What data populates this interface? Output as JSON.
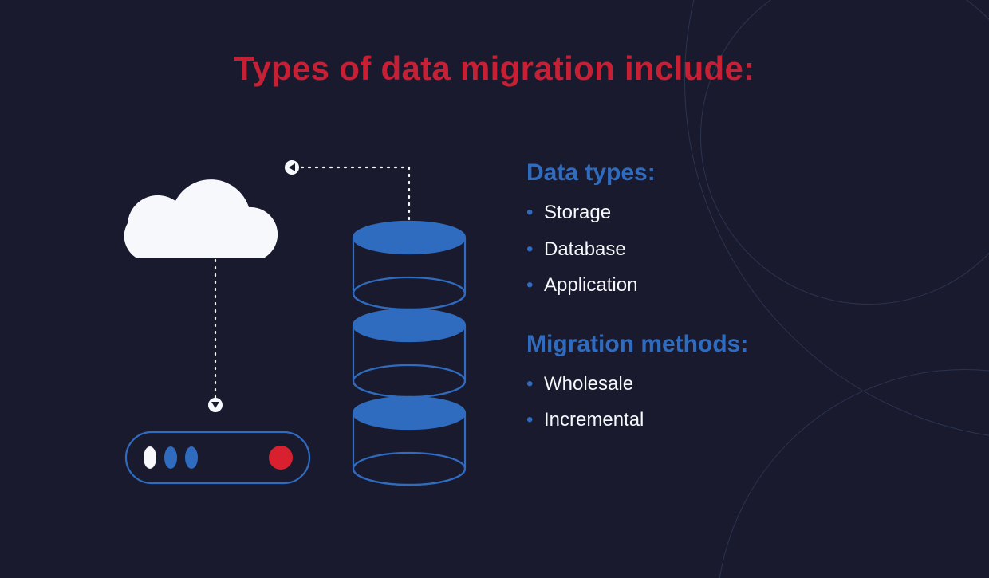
{
  "title": "Types of data migration include:",
  "sections": [
    {
      "heading": "Data types:",
      "items": [
        "Storage",
        "Database",
        "Application"
      ]
    },
    {
      "heading": "Migration methods:",
      "items": [
        "Wholesale",
        "Incremental"
      ]
    }
  ],
  "colors": {
    "background": "#191a2e",
    "title": "#c72035",
    "accent_blue": "#2f6cc0",
    "text": "#f7f8fc",
    "red_dot": "#d8202f"
  },
  "diagram": {
    "nodes": [
      "cloud",
      "database-stack",
      "server-device"
    ],
    "arrows": [
      {
        "from": "database-stack",
        "to": "cloud",
        "style": "dotted"
      },
      {
        "from": "cloud",
        "to": "server-device",
        "style": "dotted"
      }
    ]
  }
}
